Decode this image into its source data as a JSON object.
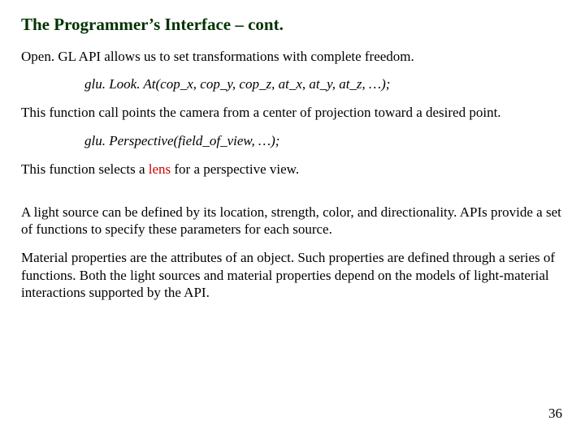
{
  "title": "The Programmer’s Interface – cont.",
  "p1": "Open. GL API allows us to set transformations with complete freedom.",
  "code1": "glu. Look. At(cop_x, cop_y, cop_z, at_x, at_y, at_z, …);",
  "p2": "This function call points the camera from a center of projection toward a desired point.",
  "code2": "glu. Perspective(field_of_view, …);",
  "p3_a": "This function selects a ",
  "p3_lens": "lens",
  "p3_b": " for a perspective view.",
  "p4": "A light source can be defined by its location, strength, color, and directionality.  APIs provide a set of functions to specify these parameters for each source.",
  "p5": "Material properties are the attributes of an object.  Such properties are defined through a series of functions.  Both the light sources and material properties depend on the models of light-material interactions supported by the API.",
  "page_number": "36"
}
